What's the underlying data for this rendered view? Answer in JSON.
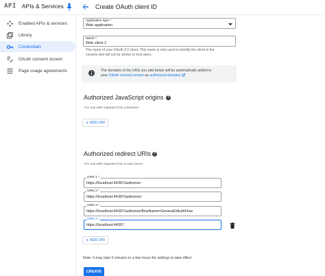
{
  "header": {
    "logo": "API",
    "product": "APIs & Services",
    "page_title": "Create OAuth client ID"
  },
  "sidebar": {
    "items": [
      {
        "label": "Enabled APIs & services",
        "icon": "diamond-grid-icon",
        "active": false
      },
      {
        "label": "Library",
        "icon": "library-icon",
        "active": false
      },
      {
        "label": "Credentials",
        "icon": "key-icon",
        "active": true
      },
      {
        "label": "OAuth consent screen",
        "icon": "consent-icon",
        "active": false
      },
      {
        "label": "Page usage agreements",
        "icon": "settings-list-icon",
        "active": false
      }
    ]
  },
  "form": {
    "app_type_label": "Application type *",
    "app_type_value": "Web application",
    "name_label": "Name *",
    "name_value": "Web client 2",
    "name_helper_1": "The name of your OAuth 2.0 client. This name is only used to identify the client in the",
    "name_helper_2": "console and will not be shown to end users.",
    "info_text_1": "The domains of the URIs you add below will be automatically added to",
    "info_text_2_pre": "your",
    "info_link_1": "OAuth consent screen",
    "info_text_2_mid": "as",
    "info_link_2": "authorized domains",
    "js_origins": {
      "title": "Authorized JavaScript origins",
      "caption": "For use with requests from a browser",
      "add_label": "ADD URI"
    },
    "redirect_uris": {
      "title": "Authorized redirect URIs",
      "caption": "For use with requests from a web server",
      "add_label": "ADD URI",
      "items": [
        {
          "label": "URIs 1 *",
          "value": "https://localhost:44397/authorize"
        },
        {
          "label": "URIs 2 *",
          "value": "https://localhost:44397/authorize/"
        },
        {
          "label": "URIs 3 *",
          "value": "https://localhost:44397/authorize/flowName=GeneralOAuthFlow"
        },
        {
          "label": "URIs 4 *",
          "value": "https://localhost:44397"
        }
      ]
    },
    "note": "Note: It may take 5 minutes to a few hours for settings to take effect",
    "create_label": "CREATE"
  },
  "colors": {
    "accent": "#1a73e8",
    "active_bg": "#e8f0fe",
    "info_bg": "#f1f3f4"
  }
}
